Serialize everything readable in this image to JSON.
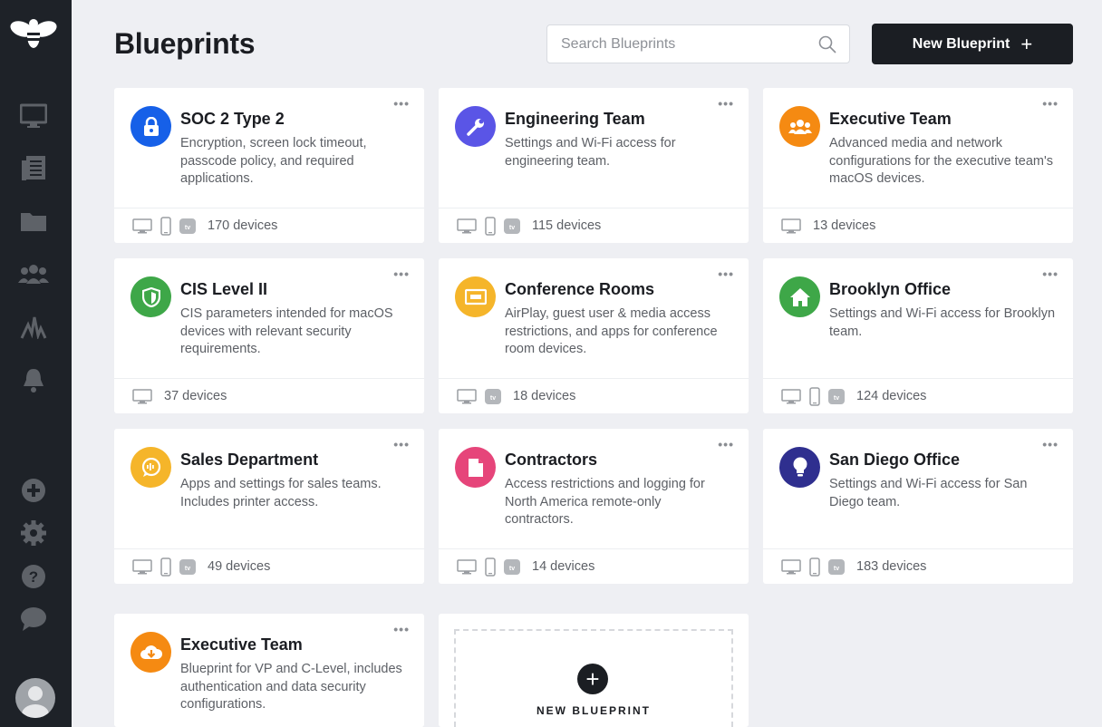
{
  "sidebar": {
    "items": [
      "logo-bee-icon",
      "monitor-icon",
      "blueprint-list-icon",
      "folder-icon",
      "users-icon",
      "activity-icon",
      "bell-icon",
      "add-circle-icon",
      "settings-gear-icon",
      "help-icon",
      "chat-icon",
      "avatar"
    ]
  },
  "header": {
    "title": "Blueprints",
    "search_placeholder": "Search Blueprints",
    "new_button_label": "New Blueprint",
    "new_button_icon": "+"
  },
  "cards": [
    {
      "title": "SOC 2 Type 2",
      "description": "Encryption, screen lock timeout, passcode policy, and required applications.",
      "count": "170 devices",
      "icon": "lock-icon",
      "color": "#1660e8",
      "devices": [
        "mac",
        "iphone",
        "appletv"
      ]
    },
    {
      "title": "Engineering Team",
      "description": "Settings and Wi-Fi access for engineering team.",
      "count": "115 devices",
      "icon": "wrench-icon",
      "color": "#5a55e6",
      "devices": [
        "mac",
        "iphone",
        "appletv"
      ]
    },
    {
      "title": "Executive Team",
      "description": "Advanced media and network configurations for the executive team's macOS devices.",
      "count": "13 devices",
      "icon": "group-icon",
      "color": "#f58a12",
      "devices": [
        "mac"
      ]
    },
    {
      "title": "CIS Level II",
      "description": "CIS parameters intended for macOS devices with relevant security requirements.",
      "count": "37 devices",
      "icon": "shield-icon",
      "color": "#3ea748",
      "devices": [
        "mac"
      ]
    },
    {
      "title": "Conference Rooms",
      "description": "AirPlay, guest user & media access restrictions, and apps for conference room devices.",
      "count": "18 devices",
      "icon": "presentation-icon",
      "color": "#f5b52a",
      "devices": [
        "mac",
        "appletv"
      ]
    },
    {
      "title": "Brooklyn Office",
      "description": "Settings and Wi-Fi access for Brooklyn team.",
      "count": "124 devices",
      "icon": "home-icon",
      "color": "#3ea748",
      "devices": [
        "mac",
        "iphone",
        "appletv"
      ]
    },
    {
      "title": "Sales Department",
      "description": "Apps and settings for sales teams. Includes printer access.",
      "count": "49 devices",
      "icon": "chat-bubble-icon",
      "color": "#f5b52a",
      "devices": [
        "mac",
        "iphone",
        "appletv"
      ]
    },
    {
      "title": "Contractors",
      "description": "Access restrictions and logging for North America remote-only contractors.",
      "count": "14 devices",
      "icon": "document-icon",
      "color": "#e6457a",
      "devices": [
        "mac",
        "iphone",
        "appletv"
      ]
    },
    {
      "title": "San Diego Office",
      "description": "Settings and Wi-Fi access for San Diego team.",
      "count": "183 devices",
      "icon": "lightbulb-icon",
      "color": "#2f2f8f",
      "devices": [
        "mac",
        "iphone",
        "appletv"
      ]
    },
    {
      "title": "Executive Team",
      "description": "Blueprint for VP and C-Level, includes authentication and data security configurations.",
      "count": "",
      "icon": "cloud-download-icon",
      "color": "#f58a12",
      "devices": []
    }
  ],
  "new_card": {
    "label": "NEW BLUEPRINT",
    "icon": "+"
  },
  "more_label": "•••"
}
